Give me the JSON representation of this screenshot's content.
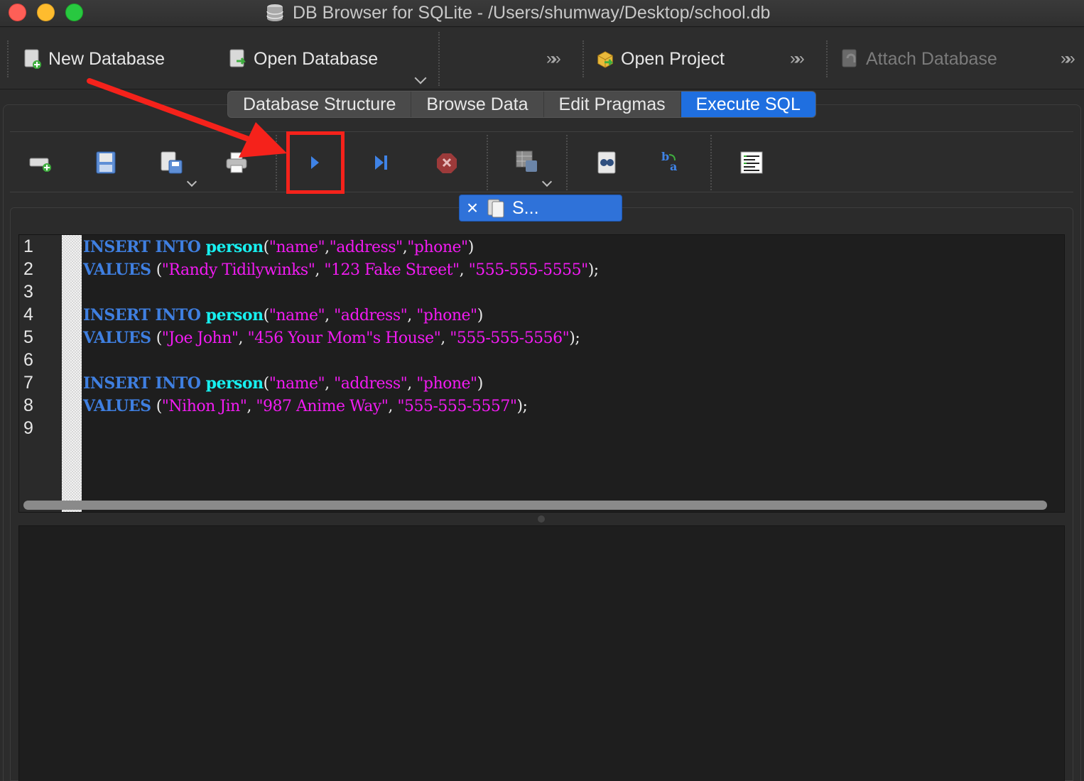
{
  "window": {
    "title": "DB Browser for SQLite - /Users/shumway/Desktop/school.db"
  },
  "toolbar": {
    "new_database": "New Database",
    "open_database": "Open Database",
    "open_project": "Open Project",
    "attach_database": "Attach Database"
  },
  "tabs": [
    {
      "label": "Database Structure"
    },
    {
      "label": "Browse Data"
    },
    {
      "label": "Edit Pragmas"
    },
    {
      "label": "Execute SQL",
      "active": true
    }
  ],
  "sql_toolbar": {
    "icons": [
      "open-tab-icon",
      "open-sql-file-icon",
      "save-sql-file-icon",
      "print-icon",
      "execute-all-icon",
      "execute-current-line-icon",
      "stop-execution-icon",
      "save-results-icon",
      "find-icon",
      "find-replace-icon",
      "comment-icon"
    ]
  },
  "editor_tab": {
    "label": "S..."
  },
  "editor": {
    "line_numbers": [
      "1",
      "2",
      "3",
      "4",
      "5",
      "6",
      "7",
      "8",
      "9"
    ],
    "lines": [
      [
        "INSERT INTO ",
        "person",
        "(",
        "\"name\"",
        ",",
        "\"address\"",
        ",",
        "\"phone\"",
        ")"
      ],
      [
        "VALUES ",
        "(",
        "\"Randy Tidilywinks\"",
        ", ",
        "\"123 Fake Street\"",
        ", ",
        "\"555-555-5555\"",
        ");"
      ],
      [],
      [
        "INSERT INTO ",
        "person",
        "(",
        "\"name\"",
        ", ",
        "\"address\"",
        ", ",
        "\"phone\"",
        ")"
      ],
      [
        "VALUES ",
        "(",
        "\"Joe John\"",
        ", ",
        "\"456 Your Mom\"s House\"",
        ", ",
        "\"555-555-5556\"",
        ");"
      ],
      [],
      [
        "INSERT INTO ",
        "person",
        "(",
        "\"name\"",
        ", ",
        "\"address\"",
        ", ",
        "\"phone\"",
        ")"
      ],
      [
        "VALUES ",
        "(",
        "\"Nihon Jin\"",
        ", ",
        "\"987 Anime Way\"",
        ", ",
        "\"555-555-5557\"",
        ");"
      ],
      []
    ]
  },
  "colors": {
    "keyword": "#3f7fe0",
    "table": "#17f0f0",
    "string": "#f21bf2",
    "active_tab": "#1f6fe0",
    "annotation": "#f5221b"
  }
}
